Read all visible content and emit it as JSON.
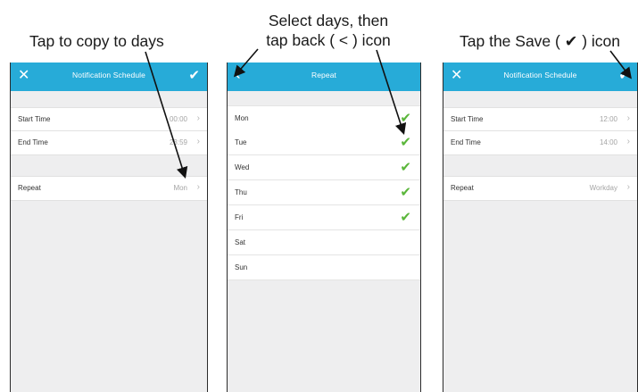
{
  "captions": {
    "left": "Tap to copy to days",
    "middle_line1": "Select days, then",
    "middle_line2": "tap back ( < ) icon",
    "right": "Tap the Save ( ✔ ) icon"
  },
  "screen1": {
    "title": "Notification Schedule",
    "close_icon": "✕",
    "save_icon": "✔",
    "rows": [
      {
        "label": "Start Time",
        "value": "00:00",
        "chevron": "›"
      },
      {
        "label": "End Time",
        "value": "23:59",
        "chevron": "›"
      },
      {
        "label": "Repeat",
        "value": "Mon",
        "chevron": "›"
      }
    ]
  },
  "screen2": {
    "title": "Repeat",
    "back_icon": "‹",
    "check_icon": "✔",
    "days": [
      {
        "label": "Mon",
        "checked": true
      },
      {
        "label": "Tue",
        "checked": true
      },
      {
        "label": "Wed",
        "checked": true
      },
      {
        "label": "Thu",
        "checked": true
      },
      {
        "label": "Fri",
        "checked": true
      },
      {
        "label": "Sat",
        "checked": false
      },
      {
        "label": "Sun",
        "checked": false
      }
    ]
  },
  "screen3": {
    "title": "Notification Schedule",
    "close_icon": "✕",
    "save_icon": "✔",
    "rows": [
      {
        "label": "Start Time",
        "value": "12:00",
        "chevron": "›"
      },
      {
        "label": "End Time",
        "value": "14:00",
        "chevron": "›"
      },
      {
        "label": "Repeat",
        "value": "Workday",
        "chevron": "›"
      }
    ]
  },
  "colors": {
    "header": "#27abd8",
    "check": "#5ab63a",
    "background": "#eeeeef"
  }
}
